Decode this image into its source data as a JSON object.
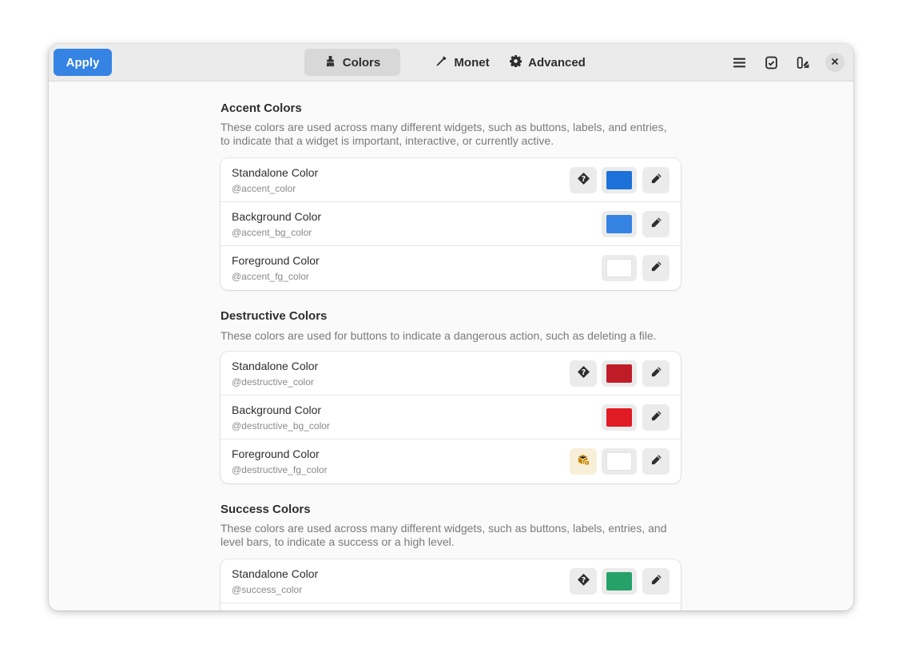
{
  "header": {
    "apply_label": "Apply",
    "tabs": [
      {
        "label": "Colors",
        "icon": "brush-icon",
        "active": true
      },
      {
        "label": "Monet",
        "icon": "eyedropper-icon",
        "active": false
      },
      {
        "label": "Advanced",
        "icon": "gear-icon",
        "active": false
      }
    ],
    "icons": [
      "menu-icon",
      "presets-icon",
      "theme-icon",
      "close-icon"
    ]
  },
  "sections": [
    {
      "title": "Accent Colors",
      "description": "These colors are used across many different widgets, such as buttons, labels, and entries, to indicate that a widget is important, interactive, or currently active.",
      "rows": [
        {
          "title": "Standalone Color",
          "variable": "@accent_color",
          "color": "#1c71d8",
          "help": true,
          "warning": false
        },
        {
          "title": "Background Color",
          "variable": "@accent_bg_color",
          "color": "#3584e4",
          "help": false,
          "warning": false
        },
        {
          "title": "Foreground Color",
          "variable": "@accent_fg_color",
          "color": "#ffffff",
          "help": false,
          "warning": false
        }
      ]
    },
    {
      "title": "Destructive Colors",
      "description": "These colors are used for buttons to indicate a dangerous action, such as deleting a file.",
      "rows": [
        {
          "title": "Standalone Color",
          "variable": "@destructive_color",
          "color": "#c01c28",
          "help": true,
          "warning": false
        },
        {
          "title": "Background Color",
          "variable": "@destructive_bg_color",
          "color": "#e01b24",
          "help": false,
          "warning": false
        },
        {
          "title": "Foreground Color",
          "variable": "@destructive_fg_color",
          "color": "#ffffff",
          "help": false,
          "warning": true
        }
      ]
    },
    {
      "title": "Success Colors",
      "description": "These colors are used across many different widgets, such as buttons, labels, entries, and level bars, to indicate a success or a high level.",
      "rows": [
        {
          "title": "Standalone Color",
          "variable": "@success_color",
          "color": "#26a269",
          "help": true,
          "warning": false
        }
      ]
    }
  ]
}
